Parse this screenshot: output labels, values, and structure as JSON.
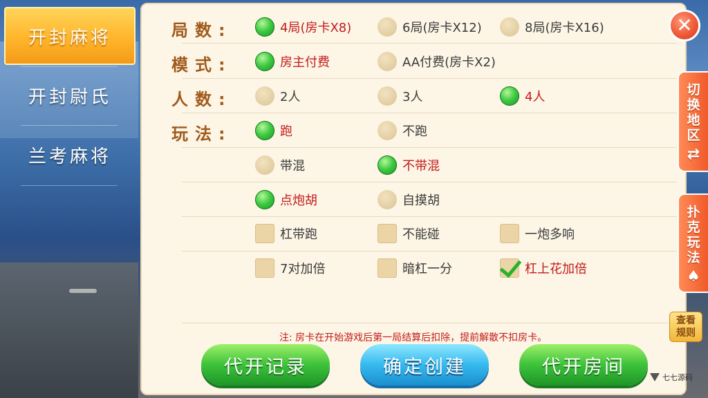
{
  "sidebar": {
    "items": [
      {
        "label": "开封麻将",
        "active": true
      },
      {
        "label": "开封尉氏",
        "active": false
      },
      {
        "label": "兰考麻将",
        "active": false
      }
    ]
  },
  "rows": {
    "rounds": {
      "label": "局数:",
      "options": [
        {
          "label": "4局(房卡X8)",
          "selected": true
        },
        {
          "label": "6局(房卡X12)",
          "selected": false
        },
        {
          "label": "8局(房卡X16)",
          "selected": false
        }
      ]
    },
    "mode": {
      "label": "模式:",
      "options": [
        {
          "label": "房主付费",
          "selected": true
        },
        {
          "label": "AA付费(房卡X2)",
          "selected": false
        }
      ]
    },
    "players": {
      "label": "人数:",
      "options": [
        {
          "label": "2人",
          "selected": false
        },
        {
          "label": "3人",
          "selected": false
        },
        {
          "label": "4人",
          "selected": true
        }
      ]
    },
    "play": {
      "label": "玩法:",
      "group1": [
        {
          "label": "跑",
          "selected": true
        },
        {
          "label": "不跑",
          "selected": false
        }
      ],
      "group2": [
        {
          "label": "带混",
          "selected": false
        },
        {
          "label": "不带混",
          "selected": true
        }
      ],
      "group3": [
        {
          "label": "点炮胡",
          "selected": true
        },
        {
          "label": "自摸胡",
          "selected": false
        }
      ],
      "checks1": [
        {
          "label": "杠带跑",
          "checked": false
        },
        {
          "label": "不能碰",
          "checked": false
        },
        {
          "label": "一炮多响",
          "checked": false
        }
      ],
      "checks2": [
        {
          "label": "7对加倍",
          "checked": false
        },
        {
          "label": "暗杠一分",
          "checked": false
        },
        {
          "label": "杠上花加倍",
          "checked": true
        }
      ]
    }
  },
  "note": "注: 房卡在开始游戏后第一局结算后扣除，提前解散不扣房卡。",
  "buttons": {
    "proxy_record": "代开记录",
    "confirm_create": "确定创建",
    "proxy_room": "代开房间"
  },
  "side_tabs": {
    "switch_region": "切换地区",
    "poker_play": "扑克玩法"
  },
  "rules_button": "查看规则",
  "close_icon": "close-icon",
  "watermark": "七七源码",
  "colors": {
    "selected_text": "#c21a1a",
    "label": "#a05a1c",
    "accent_orange": "#f05a2a"
  }
}
